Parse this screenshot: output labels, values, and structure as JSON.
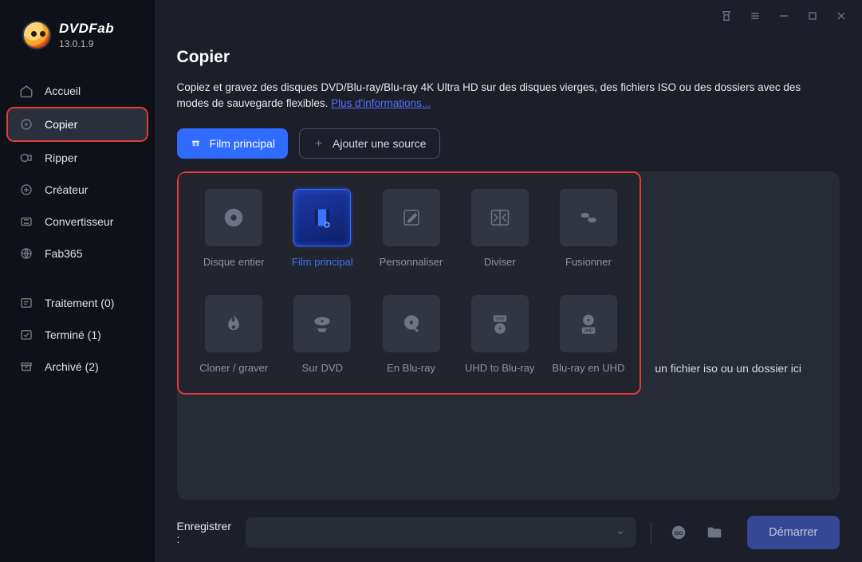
{
  "brand": {
    "name": "DVDFab",
    "version": "13.0.1.9"
  },
  "sidebar": {
    "items": [
      {
        "label": "Accueil"
      },
      {
        "label": "Copier"
      },
      {
        "label": "Ripper"
      },
      {
        "label": "Créateur"
      },
      {
        "label": "Convertisseur"
      },
      {
        "label": "Fab365"
      }
    ],
    "queue": [
      {
        "label": "Traitement (0)"
      },
      {
        "label": "Terminé (1)"
      },
      {
        "label": "Archivé (2)"
      }
    ],
    "active_index": 1
  },
  "page": {
    "title": "Copier",
    "description": "Copiez et gravez des disques DVD/Blu-ray/Blu-ray 4K Ultra HD sur des disques vierges, des fichiers ISO ou des dossiers avec des modes de sauvegarde flexibles. ",
    "more_link": "Plus d'informations..."
  },
  "toolbar": {
    "primary_label": "Film principal",
    "add_source_label": "Ajouter une source"
  },
  "modes": {
    "active_index": 1,
    "items": [
      {
        "label": "Disque entier"
      },
      {
        "label": "Film principal"
      },
      {
        "label": "Personnaliser"
      },
      {
        "label": "Diviser"
      },
      {
        "label": "Fusionner"
      },
      {
        "label": "Cloner / graver"
      },
      {
        "label": "Sur DVD"
      },
      {
        "label": "En Blu-ray"
      },
      {
        "label": "UHD to Blu-ray"
      },
      {
        "label": "Blu-ray en UHD"
      }
    ]
  },
  "dropzone": {
    "hint_suffix": "un fichier iso ou un dossier ici"
  },
  "footer": {
    "save_label": "Enregistrer :",
    "start_label": "Démarrer"
  }
}
